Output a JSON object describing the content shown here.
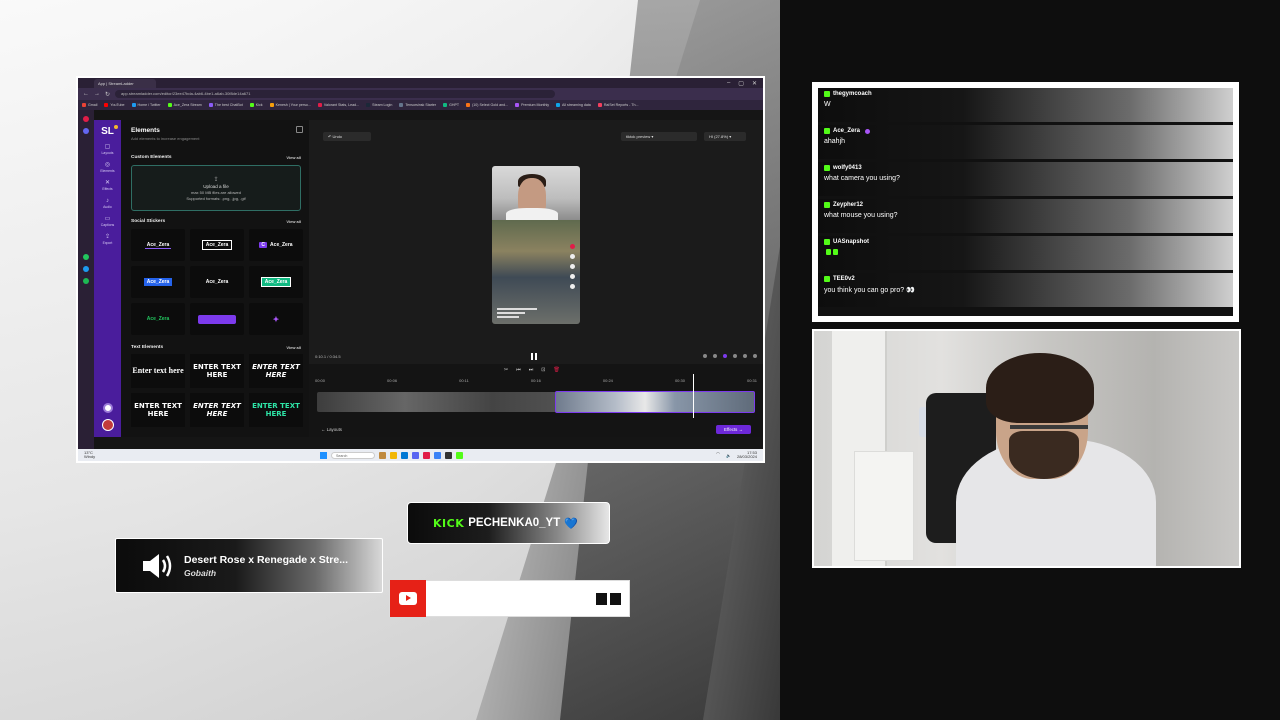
{
  "browser": {
    "tab_title": "App | StreamLadder",
    "url": "app.streamladder.com/editor/23ee47bda-4ab6-4be1-a6ab-30f8de14a671",
    "bookmarks": [
      "Gmail",
      "YouTube",
      "Home / Twitter",
      "Ace_Zera Stream",
      "The best ChatBot",
      "Kick",
      "Kenesh | Your perso...",
      "Valorant Stats, Lead...",
      "Steam Login",
      "Tensorsinsk Starter",
      "GHPT",
      "(10) Select Gold and...",
      "Premium Monthly",
      "All streaming data",
      "RaiSet Reports - Th..."
    ]
  },
  "rail": {
    "logo": "SL",
    "items": [
      {
        "icon": "▢",
        "label": "Layouts"
      },
      {
        "icon": "◎",
        "label": "Elements"
      },
      {
        "icon": "✕",
        "label": "Effects"
      },
      {
        "icon": "♪",
        "label": "Audio"
      },
      {
        "icon": "▭",
        "label": "Captions"
      },
      {
        "icon": "⇪",
        "label": "Export"
      }
    ]
  },
  "panel": {
    "title": "Elements",
    "subtitle": "Add elements to increase engagement",
    "custom_heading": "Custom Elements",
    "view_all": "View all",
    "upload_title": "Upload a file",
    "upload_note1": "max 50 MB files are allowed",
    "upload_note2": "Supported formats: .png, .jpg, .gif",
    "social_heading": "Social Stickers",
    "stickers": [
      "Ace_Zera",
      "Ace_Zera",
      "Ace_Zera",
      "Ace_Zera",
      "Ace_Zera",
      "Ace_Zera",
      "Ace_Zera",
      "",
      "✦"
    ],
    "sticker_prefix": "C",
    "text_heading": "Text Elements",
    "texts": [
      "Enter text here",
      "ENTER TEXT HERE",
      "ENTER TEXT HERE",
      "ENTER TEXT HERE",
      "ENTER TEXT HERE",
      "ENTER TEXT HERE"
    ]
  },
  "workspace": {
    "undo": "Undo",
    "preview_select": "tiktok preview",
    "quality_select": "HI (27.8%)",
    "time": "0:10.1 / 0:34.5",
    "ticks": [
      "00:00",
      "00:06",
      "00:11",
      "00:16",
      "00:24",
      "00:30",
      "00:31"
    ],
    "back_link": "Layouts",
    "next_button": "Effects"
  },
  "taskbar": {
    "weather_temp": "13°C",
    "weather_desc": "Windy",
    "search": "Search",
    "time": "17:53",
    "date": "28/03/2024"
  },
  "chat": [
    {
      "user": "thegymcoach",
      "msg": "W"
    },
    {
      "user": "Ace_Zera",
      "msg": "ahahjh"
    },
    {
      "user": "wolfy0413",
      "msg": "what camera you using?"
    },
    {
      "user": "Zeypher12",
      "msg": "what mouse you using?"
    },
    {
      "user": "UASnapshot",
      "msg": ""
    },
    {
      "user": "TEE0v2",
      "msg": "you think you can go pro?"
    }
  ],
  "now_playing": {
    "title": "Desert Rose x Renegade x Stre...",
    "artist": "Gobaith"
  },
  "kick": {
    "logo": "KICK",
    "handle": "PECHENKA0_YT",
    "heart": "💙",
    "accent": "#53fc18"
  },
  "youtube": {
    "accent": "#e62117"
  }
}
